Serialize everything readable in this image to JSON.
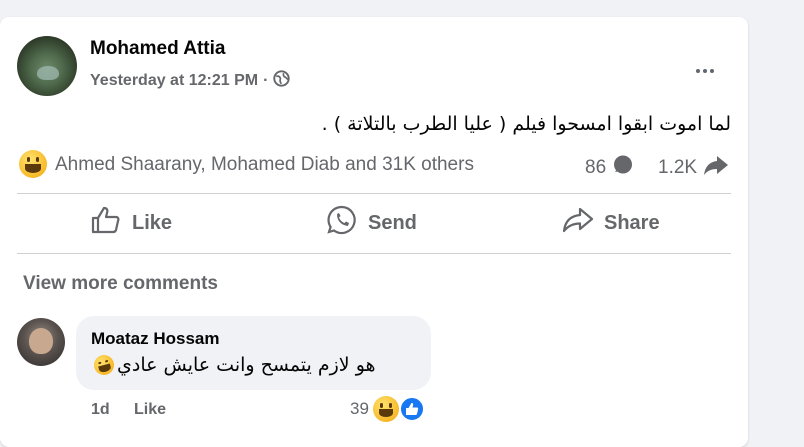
{
  "post": {
    "author": "Mohamed Attia",
    "timestamp": "Yesterday at 12:21 PM",
    "separator": "·",
    "privacy_icon": "globe-icon",
    "text": "لما اموت ابقوا امسحوا فيلم ( عليا الطرب بالتلاتة ) ."
  },
  "reactions": {
    "names": "Ahmed Shaarany, Mohamed Diab and 31K others",
    "comments_count": "86",
    "shares_count": "1.2K"
  },
  "actions": {
    "like_label": "Like",
    "send_label": "Send",
    "share_label": "Share"
  },
  "comments": {
    "view_more_label": "View more comments",
    "items": [
      {
        "name": "Moataz Hossam",
        "text": "هو لازم يتمسح وانت عايش عادي",
        "time": "1d",
        "like_label": "Like",
        "reaction_count": "39"
      }
    ]
  },
  "colors": {
    "secondary_text": "#65676b",
    "brand_blue": "#1877f2",
    "reaction_yellow": "#f7b928"
  }
}
